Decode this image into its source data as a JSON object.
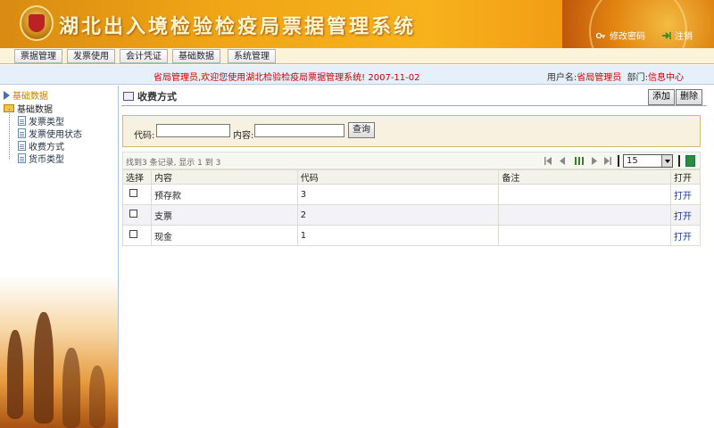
{
  "app": {
    "title": "湖北出入境检验检疫局票据管理系统",
    "links": {
      "change_password": "修改密码",
      "logout": "注销"
    }
  },
  "nav": {
    "tabs": [
      "票据管理",
      "发票使用",
      "会计凭证",
      "基础数据",
      "系统管理"
    ]
  },
  "welcome": {
    "message": "省局管理员,欢迎您使用湖北检验检疫局票据管理系统! 2007-11-02",
    "user_label": "用户名:",
    "user_value": "省局管理员",
    "dept_label": "部门:",
    "dept_value": "信息中心"
  },
  "sidebar": {
    "root": "基础数据",
    "folder": "基础数据",
    "items": [
      "发票类型",
      "发票使用状态",
      "收费方式",
      "货币类型"
    ]
  },
  "main": {
    "title": "收费方式",
    "add_label": "添加",
    "delete_label": "删除",
    "search": {
      "code_label": "代码:",
      "code_value": "",
      "content_label": "内容:",
      "content_value": "",
      "query_label": "查询"
    },
    "pager": {
      "info": "找到3 条记录, 显示 1 到 3",
      "page_size": "15"
    },
    "table": {
      "headers": [
        "选择",
        "内容",
        "代码",
        "备注",
        "打开"
      ],
      "rows": [
        {
          "content": "预存款",
          "code": "3",
          "note": "",
          "open": "打开"
        },
        {
          "content": "支票",
          "code": "2",
          "note": "",
          "open": "打开"
        },
        {
          "content": "现金",
          "code": "1",
          "note": "",
          "open": "打开"
        }
      ]
    }
  },
  "colors": {
    "header": "#f0a516",
    "accent_red": "#cc0000",
    "link_blue": "#1a3a9a"
  }
}
